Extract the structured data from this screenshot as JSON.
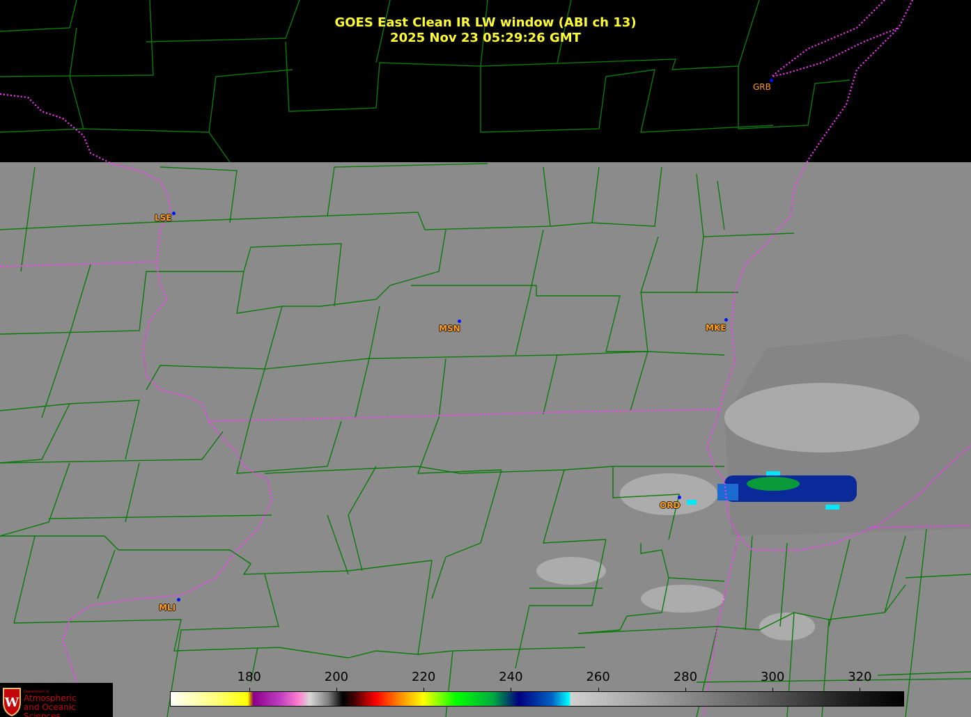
{
  "title": {
    "line1": "GOES East Clean IR LW window (ABI ch 13)",
    "line2": "2025 Nov 23  05:29:26 GMT"
  },
  "cities": [
    {
      "code": "GRB"
    },
    {
      "code": "LSE"
    },
    {
      "code": "MSN"
    },
    {
      "code": "MKE"
    },
    {
      "code": "ORD"
    },
    {
      "code": "MLI"
    }
  ],
  "colorbar": {
    "unit_ticks": [
      "180",
      "200",
      "220",
      "240",
      "260",
      "280",
      "300",
      "320"
    ],
    "range": [
      162,
      330
    ]
  },
  "logo": {
    "small": "Department of",
    "line1": "Atmospheric",
    "line2": "and Oceanic Sciences"
  },
  "colors": {
    "title": "#ffff33",
    "county": "#0a7a0a",
    "state": "#ff33ff",
    "city": "#ff9a1a",
    "land": "#8b8b8b"
  }
}
